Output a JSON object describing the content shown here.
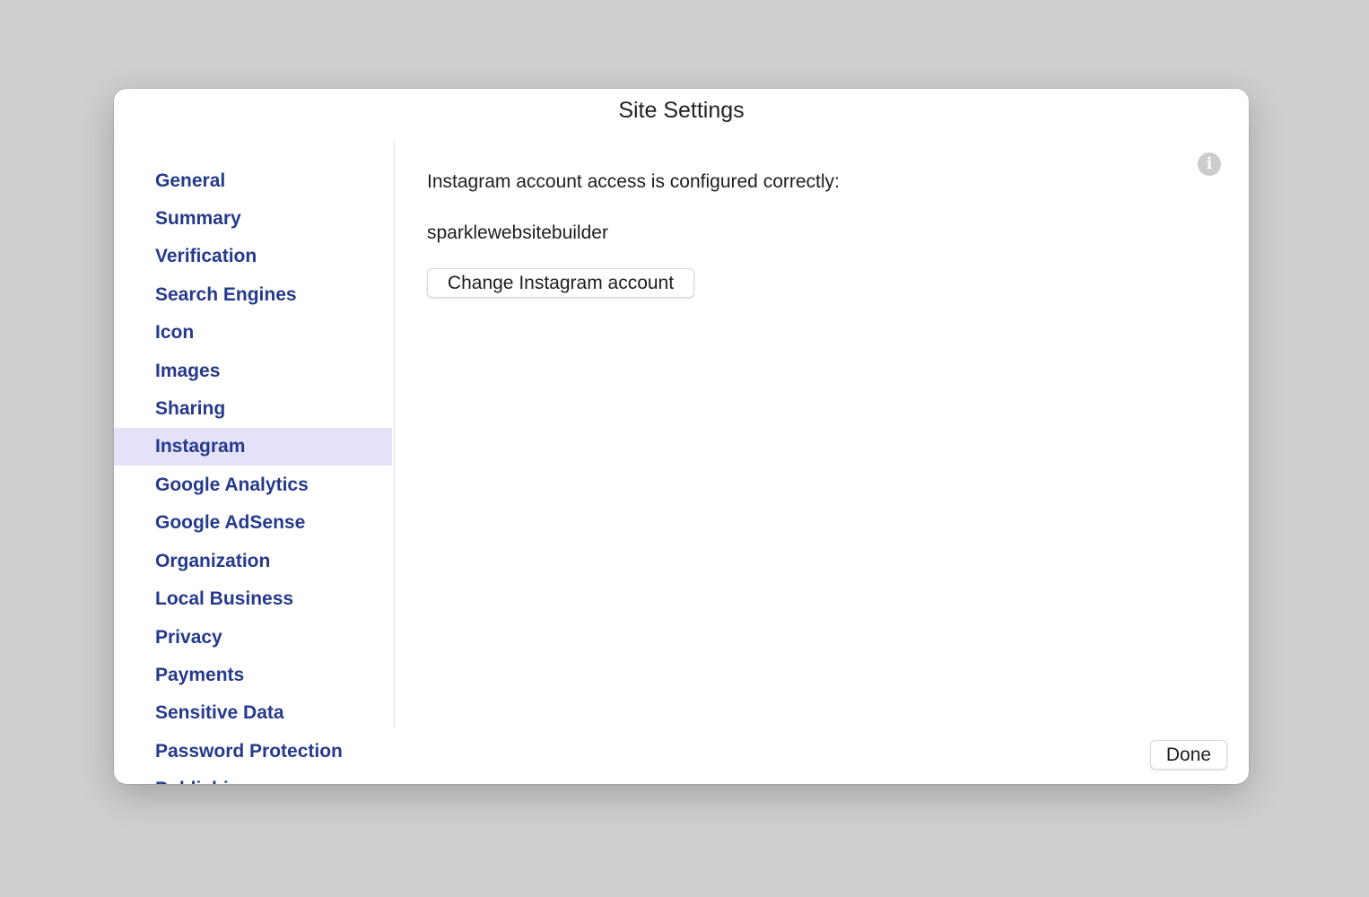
{
  "window": {
    "title": "Site Settings"
  },
  "sidebar": {
    "items": [
      {
        "label": "General",
        "selected": false
      },
      {
        "label": "Summary",
        "selected": false
      },
      {
        "label": "Verification",
        "selected": false
      },
      {
        "label": "Search Engines",
        "selected": false
      },
      {
        "label": "Icon",
        "selected": false
      },
      {
        "label": "Images",
        "selected": false
      },
      {
        "label": "Sharing",
        "selected": false
      },
      {
        "label": "Instagram",
        "selected": true
      },
      {
        "label": "Google Analytics",
        "selected": false
      },
      {
        "label": "Google AdSense",
        "selected": false
      },
      {
        "label": "Organization",
        "selected": false
      },
      {
        "label": "Local Business",
        "selected": false
      },
      {
        "label": "Privacy",
        "selected": false
      },
      {
        "label": "Payments",
        "selected": false
      },
      {
        "label": "Sensitive Data",
        "selected": false
      },
      {
        "label": "Password Protection",
        "selected": false
      },
      {
        "label": "Publishing",
        "selected": false
      }
    ]
  },
  "content": {
    "status_text": "Instagram account access is configured correctly:",
    "account_name": "sparklewebsitebuilder",
    "change_button": "Change Instagram account",
    "info_icon": "info-icon"
  },
  "footer": {
    "done_button": "Done"
  },
  "colors": {
    "accent": "#253a8c",
    "selected_bg": "#e4e1f8"
  }
}
